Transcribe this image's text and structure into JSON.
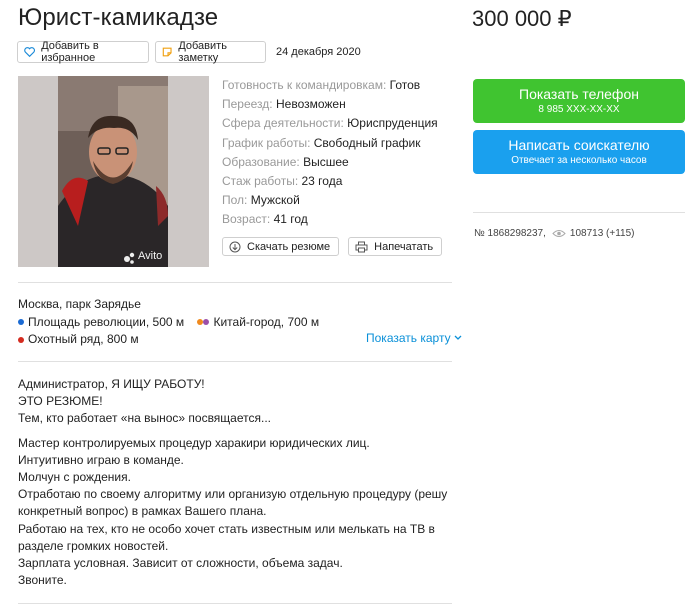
{
  "title": "Юрист-камикадзе",
  "price": "300 000 ₽",
  "toolbar": {
    "favorite_label": "Добавить в избранное",
    "note_label": "Добавить заметку",
    "date": "24 декабря 2020"
  },
  "photo": {
    "watermark": "Avito"
  },
  "params": [
    {
      "key": "Готовность к командировкам:",
      "value": "Готов"
    },
    {
      "key": "Переезд:",
      "value": "Невозможен"
    },
    {
      "key": "Сфера деятельности:",
      "value": "Юриспруденция"
    },
    {
      "key": "График работы:",
      "value": "Свободный график"
    },
    {
      "key": "Образование:",
      "value": "Высшее"
    },
    {
      "key": "Стаж работы:",
      "value": "23 года"
    },
    {
      "key": "Пол:",
      "value": "Мужской"
    },
    {
      "key": "Возраст:",
      "value": "41 год"
    }
  ],
  "actions": {
    "download_label": "Скачать резюме",
    "print_label": "Напечатать"
  },
  "location": {
    "address": "Москва, парк Зарядье",
    "metro": [
      {
        "name": "Площадь революции,",
        "distance": "500 м",
        "colors": [
          "#1a6ad3"
        ]
      },
      {
        "name": "Китай-город,",
        "distance": "700 м",
        "colors": [
          "#f08a1e",
          "#9b4fa8"
        ]
      },
      {
        "name": "Охотный ряд,",
        "distance": "800 м",
        "colors": [
          "#d42b1f"
        ]
      }
    ],
    "show_map_label": "Показать карту"
  },
  "description": [
    "Администратор, Я ИЩУ РАБОТУ!\nЭТО РЕЗЮМЕ!\nТем, кто работает «на вынос» посвящается...",
    "Мастер контролируемых процедур харакири юридических лиц.\nИнтуитивно играю в команде.\nМолчун с рождения.\nОтработаю по своему алгоритму или организую отдельную процедуру (решу конкретный вопрос) в рамках Вашего плана.\nРаботаю на тех, кто не особо хочет стать известным или мелькать на ТВ в разделе громких новостей.\nЗарплата условная. Зависит от сложности, объема задач.\nЗвоните."
  ],
  "contact": {
    "phone_label": "Показать телефон",
    "phone_masked": "8 985 XXX-XX-XX",
    "write_label": "Написать соискателю",
    "write_sub": "Отвечает за несколько часов"
  },
  "stats": {
    "ad_number": "№ 1868298237,",
    "views": "108713 (+115)"
  },
  "colors": {
    "green": "#40c430",
    "blue": "#1aa0ee",
    "link": "#0a90d8"
  }
}
